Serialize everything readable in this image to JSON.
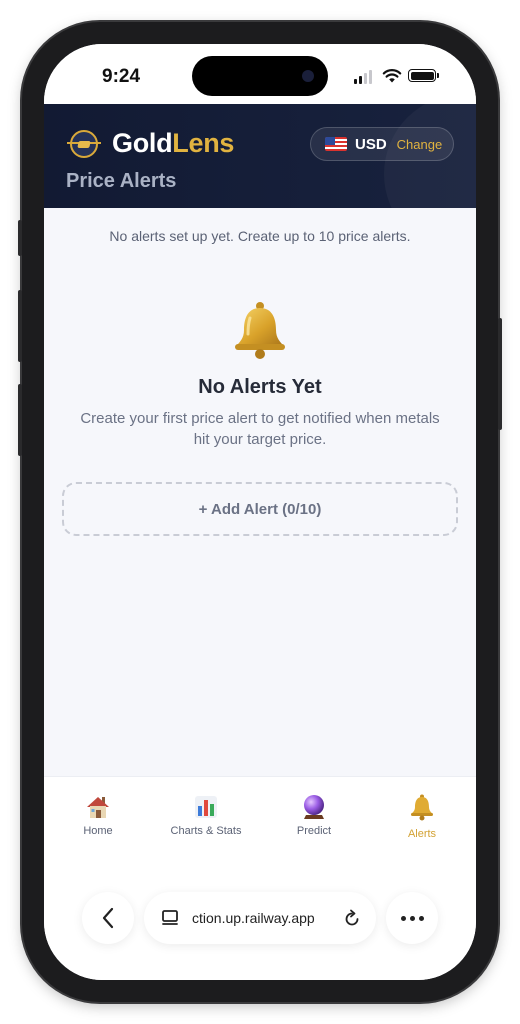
{
  "status_bar": {
    "time": "9:24"
  },
  "header": {
    "brand_primary": "Gold",
    "brand_accent": "Lens",
    "subtitle": "Price Alerts",
    "currency_code": "USD",
    "currency_change": "Change"
  },
  "main": {
    "hint": "No alerts set up yet. Create up to 10 price alerts.",
    "empty_title": "No Alerts Yet",
    "empty_description": "Create your first price alert to get notified when metals hit your target price.",
    "add_alert_label": "+ Add Alert (0/10)"
  },
  "tabs": [
    {
      "label": "Home",
      "icon": "house-icon"
    },
    {
      "label": "Charts & Stats",
      "icon": "bar-chart-icon"
    },
    {
      "label": "Predict",
      "icon": "crystal-ball-icon"
    },
    {
      "label": "Alerts",
      "icon": "bell-icon",
      "active": true
    }
  ],
  "browser": {
    "url": "ction.up.railway.app"
  },
  "colors": {
    "header_bg": "#121a33",
    "accent_gold": "#e1b340",
    "active_tab": "#d3a234"
  }
}
